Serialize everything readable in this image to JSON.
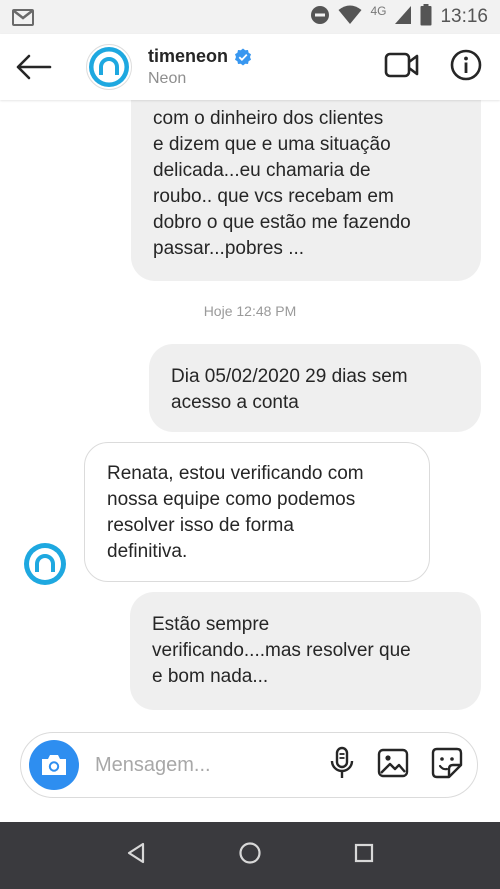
{
  "status_bar": {
    "network": "4G",
    "time": "13:16"
  },
  "header": {
    "name": "timeneon",
    "subtitle": "Neon",
    "verified": true
  },
  "messages": [
    {
      "sender": "me",
      "text": "com o dinheiro dos clientes\ne dizem que e uma situação\ndelicada...eu chamaria de\nroubo.. que vcs recebam em\ndobro o que estão me fazendo\npassar...pobres ..."
    },
    {
      "sender": "me",
      "text": "Dia 05/02/2020 29 dias sem\nacesso a conta"
    },
    {
      "sender": "timeneon",
      "text": "Renata, estou verificando com\nnossa equipe como podemos\nresolver isso de forma\ndefinitiva."
    },
    {
      "sender": "me",
      "text": "Estão sempre\nverificando....mas resolver que\ne bom nada..."
    }
  ],
  "timestamp_separator": "Hoje 12:48 PM",
  "composer": {
    "placeholder": "Mensagem..."
  },
  "colors": {
    "accent": "#2e8ef0",
    "verified_badge": "#3897f0",
    "bubble_gray": "#efefef",
    "nav_bar": "#3a3a3e",
    "brand_ring": "#1ea8e0"
  },
  "icons": {
    "status": [
      "gmail-icon",
      "dnd-icon",
      "wifi-icon",
      "signal-icon",
      "battery-icon"
    ],
    "header": [
      "back-arrow-icon",
      "video-call-icon",
      "info-icon"
    ],
    "composer": [
      "camera-icon",
      "microphone-icon",
      "gallery-icon",
      "sticker-icon"
    ],
    "nav": [
      "nav-back-icon",
      "nav-home-icon",
      "nav-recents-icon"
    ]
  }
}
